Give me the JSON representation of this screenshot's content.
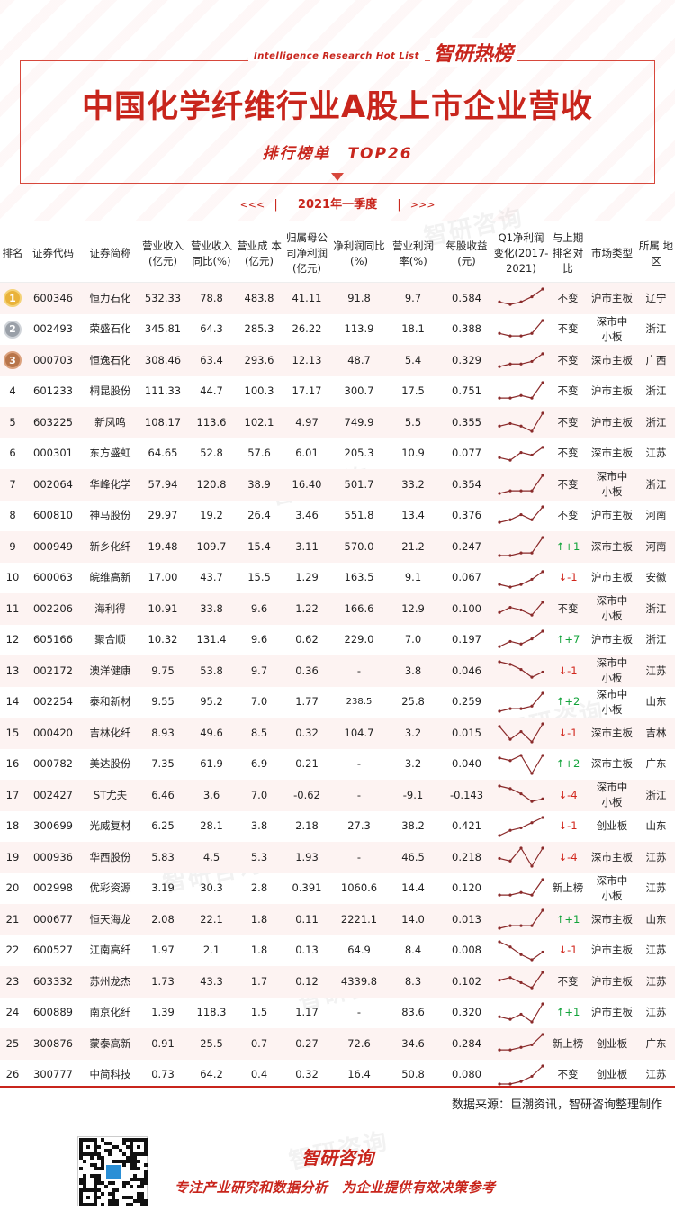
{
  "header": {
    "en_label": "Intelligence Research Hot List",
    "cn_label": "智研热榜",
    "title": "中国化学纤维行业A股上市企业营收",
    "subtitle": "排行榜单　TOP26",
    "period": "2021年一季度",
    "period_left_arrows": "<<<",
    "period_right_arrows": ">>>"
  },
  "columns": {
    "rank": "排名",
    "code": "证券代码",
    "name": "证券简称",
    "rev": "营业收入 (亿元)",
    "rev_yoy": "营业收入 同比(%)",
    "cost": "营业成 本(亿元)",
    "net_profit": "归属母公 司净利润 (亿元)",
    "np_yoy": "净利润同比 (%)",
    "margin": "营业利润 率(%)",
    "eps": "每股收益 (元)",
    "spark": "Q1净利润 变化(2017- 2021)",
    "rank_change": "与上期 排名对 比",
    "market": "市场类型",
    "region": "所属 地区"
  },
  "rows": [
    {
      "rank": "1",
      "code": "600346",
      "name": "恒力石化",
      "rev": "532.33",
      "rev_yoy": "78.8",
      "cost": "483.8",
      "np": "41.11",
      "np_yoy": "91.8",
      "margin": "9.7",
      "eps": "0.584",
      "change": "不变",
      "market": "沪市主板",
      "region": "辽宁",
      "trend": [
        3,
        2,
        3,
        5,
        8
      ]
    },
    {
      "rank": "2",
      "code": "002493",
      "name": "荣盛石化",
      "rev": "345.81",
      "rev_yoy": "64.3",
      "cost": "285.3",
      "np": "26.22",
      "np_yoy": "113.9",
      "margin": "18.1",
      "eps": "0.388",
      "change": "不变",
      "market": "深市中小板",
      "region": "浙江",
      "trend": [
        3,
        2,
        2,
        3,
        8
      ]
    },
    {
      "rank": "3",
      "code": "000703",
      "name": "恒逸石化",
      "rev": "308.46",
      "rev_yoy": "63.4",
      "cost": "293.6",
      "np": "12.13",
      "np_yoy": "48.7",
      "margin": "5.4",
      "eps": "0.329",
      "change": "不变",
      "market": "深市主板",
      "region": "广西",
      "trend": [
        2,
        3,
        3,
        4,
        7
      ]
    },
    {
      "rank": "4",
      "code": "601233",
      "name": "桐昆股份",
      "rev": "111.33",
      "rev_yoy": "44.7",
      "cost": "100.3",
      "np": "17.17",
      "np_yoy": "300.7",
      "margin": "17.5",
      "eps": "0.751",
      "change": "不变",
      "market": "沪市主板",
      "region": "浙江",
      "trend": [
        2,
        2,
        3,
        2,
        8
      ]
    },
    {
      "rank": "5",
      "code": "603225",
      "name": "新凤鸣",
      "rev": "108.17",
      "rev_yoy": "113.6",
      "cost": "102.1",
      "np": "4.97",
      "np_yoy": "749.9",
      "margin": "5.5",
      "eps": "0.355",
      "change": "不变",
      "market": "沪市主板",
      "region": "浙江",
      "trend": [
        3,
        4,
        3,
        1,
        8
      ]
    },
    {
      "rank": "6",
      "code": "000301",
      "name": "东方盛虹",
      "rev": "64.65",
      "rev_yoy": "52.8",
      "cost": "57.6",
      "np": "6.01",
      "np_yoy": "205.3",
      "margin": "10.9",
      "eps": "0.077",
      "change": "不变",
      "market": "深市主板",
      "region": "江苏",
      "trend": [
        3,
        2,
        5,
        4,
        7
      ]
    },
    {
      "rank": "7",
      "code": "002064",
      "name": "华峰化学",
      "rev": "57.94",
      "rev_yoy": "120.8",
      "cost": "38.9",
      "np": "16.40",
      "np_yoy": "501.7",
      "margin": "33.2",
      "eps": "0.354",
      "change": "不变",
      "market": "深市中小板",
      "region": "浙江",
      "trend": [
        1,
        2,
        2,
        2,
        8
      ]
    },
    {
      "rank": "8",
      "code": "600810",
      "name": "神马股份",
      "rev": "29.97",
      "rev_yoy": "19.2",
      "cost": "26.4",
      "np": "3.46",
      "np_yoy": "551.8",
      "margin": "13.4",
      "eps": "0.376",
      "change": "不变",
      "market": "沪市主板",
      "region": "河南",
      "trend": [
        2,
        3,
        5,
        3,
        8
      ]
    },
    {
      "rank": "9",
      "code": "000949",
      "name": "新乡化纤",
      "rev": "19.48",
      "rev_yoy": "109.7",
      "cost": "15.4",
      "np": "3.11",
      "np_yoy": "570.0",
      "margin": "21.2",
      "eps": "0.247",
      "change": "↑+1",
      "market": "深市主板",
      "region": "河南",
      "trend": [
        1,
        1,
        2,
        2,
        8
      ]
    },
    {
      "rank": "10",
      "code": "600063",
      "name": "皖维高新",
      "rev": "17.00",
      "rev_yoy": "43.7",
      "cost": "15.5",
      "np": "1.29",
      "np_yoy": "163.5",
      "margin": "9.1",
      "eps": "0.067",
      "change": "↓-1",
      "market": "沪市主板",
      "region": "安徽",
      "trend": [
        2,
        1,
        2,
        4,
        7
      ]
    },
    {
      "rank": "11",
      "code": "002206",
      "name": "海利得",
      "rev": "10.91",
      "rev_yoy": "33.8",
      "cost": "9.6",
      "np": "1.22",
      "np_yoy": "166.6",
      "margin": "12.9",
      "eps": "0.100",
      "change": "不变",
      "market": "深市中小板",
      "region": "浙江",
      "trend": [
        3,
        5,
        4,
        2,
        7
      ]
    },
    {
      "rank": "12",
      "code": "605166",
      "name": "聚合顺",
      "rev": "10.32",
      "rev_yoy": "131.4",
      "cost": "9.6",
      "np": "0.62",
      "np_yoy": "229.0",
      "margin": "7.0",
      "eps": "0.197",
      "change": "↑+7",
      "market": "沪市主板",
      "region": "浙江",
      "trend": [
        2,
        4,
        3,
        5,
        8
      ]
    },
    {
      "rank": "13",
      "code": "002172",
      "name": "澳洋健康",
      "rev": "9.75",
      "rev_yoy": "53.8",
      "cost": "9.7",
      "np": "0.36",
      "np_yoy": "-",
      "margin": "3.8",
      "eps": "0.046",
      "change": "↓-1",
      "market": "深市中小板",
      "region": "江苏",
      "trend": [
        8,
        7,
        5,
        2,
        4
      ]
    },
    {
      "rank": "14",
      "code": "002254",
      "name": "泰和新材",
      "rev": "9.55",
      "rev_yoy": "95.2",
      "cost": "7.0",
      "np": "1.77",
      "np_yoy": "238.5",
      "margin": "25.8",
      "eps": "0.259",
      "change": "↑+2",
      "market": "深市中小板",
      "region": "山东",
      "trend": [
        1,
        2,
        2,
        3,
        8
      ]
    },
    {
      "rank": "15",
      "code": "000420",
      "name": "吉林化纤",
      "rev": "8.93",
      "rev_yoy": "49.6",
      "cost": "8.5",
      "np": "0.32",
      "np_yoy": "104.7",
      "margin": "3.2",
      "eps": "0.015",
      "change": "↓-1",
      "market": "深市主板",
      "region": "吉林",
      "trend": [
        7,
        2,
        5,
        1,
        8
      ]
    },
    {
      "rank": "16",
      "code": "000782",
      "name": "美达股份",
      "rev": "7.35",
      "rev_yoy": "61.9",
      "cost": "6.9",
      "np": "0.21",
      "np_yoy": "-",
      "margin": "3.2",
      "eps": "0.040",
      "change": "↑+2",
      "market": "深市主板",
      "region": "广东",
      "trend": [
        7,
        6,
        8,
        1,
        8
      ]
    },
    {
      "rank": "17",
      "code": "002427",
      "name": "ST尤夫",
      "rev": "6.46",
      "rev_yoy": "3.6",
      "cost": "7.0",
      "np": "-0.62",
      "np_yoy": "-",
      "margin": "-9.1",
      "eps": "-0.143",
      "change": "↓-4",
      "market": "深市中小板",
      "region": "浙江",
      "trend": [
        8,
        7,
        5,
        2,
        3
      ]
    },
    {
      "rank": "18",
      "code": "300699",
      "name": "光威复材",
      "rev": "6.25",
      "rev_yoy": "28.1",
      "cost": "3.8",
      "np": "2.18",
      "np_yoy": "27.3",
      "margin": "38.2",
      "eps": "0.421",
      "change": "↓-1",
      "market": "创业板",
      "region": "山东",
      "trend": [
        1,
        3,
        4,
        6,
        8
      ]
    },
    {
      "rank": "19",
      "code": "000936",
      "name": "华西股份",
      "rev": "5.83",
      "rev_yoy": "4.5",
      "cost": "5.3",
      "np": "1.93",
      "np_yoy": "-",
      "margin": "46.5",
      "eps": "0.218",
      "change": "↓-4",
      "market": "深市主板",
      "region": "江苏",
      "trend": [
        4,
        3,
        8,
        1,
        8
      ]
    },
    {
      "rank": "20",
      "code": "002998",
      "name": "优彩资源",
      "rev": "3.19",
      "rev_yoy": "30.3",
      "cost": "2.8",
      "np": "0.391",
      "np_yoy": "1060.6",
      "margin": "14.4",
      "eps": "0.120",
      "change": "新上榜",
      "market": "深市中小板",
      "region": "江苏",
      "trend": [
        2,
        2,
        3,
        2,
        8
      ]
    },
    {
      "rank": "21",
      "code": "000677",
      "name": "恒天海龙",
      "rev": "2.08",
      "rev_yoy": "22.1",
      "cost": "1.8",
      "np": "0.11",
      "np_yoy": "2221.1",
      "margin": "14.0",
      "eps": "0.013",
      "change": "↑+1",
      "market": "深市主板",
      "region": "山东",
      "trend": [
        1,
        2,
        2,
        2,
        8
      ]
    },
    {
      "rank": "22",
      "code": "600527",
      "name": "江南高纤",
      "rev": "1.97",
      "rev_yoy": "2.1",
      "cost": "1.8",
      "np": "0.13",
      "np_yoy": "64.9",
      "margin": "8.4",
      "eps": "0.008",
      "change": "↓-1",
      "market": "沪市主板",
      "region": "江苏",
      "trend": [
        8,
        6,
        3,
        1,
        4
      ]
    },
    {
      "rank": "23",
      "code": "603332",
      "name": "苏州龙杰",
      "rev": "1.73",
      "rev_yoy": "43.3",
      "cost": "1.7",
      "np": "0.12",
      "np_yoy": "4339.8",
      "margin": "8.3",
      "eps": "0.102",
      "change": "不变",
      "market": "沪市主板",
      "region": "江苏",
      "trend": [
        5,
        6,
        4,
        2,
        8
      ]
    },
    {
      "rank": "24",
      "code": "600889",
      "name": "南京化纤",
      "rev": "1.39",
      "rev_yoy": "118.3",
      "cost": "1.5",
      "np": "1.17",
      "np_yoy": "-",
      "margin": "83.6",
      "eps": "0.320",
      "change": "↑+1",
      "market": "沪市主板",
      "region": "江苏",
      "trend": [
        3,
        2,
        4,
        1,
        8
      ]
    },
    {
      "rank": "25",
      "code": "300876",
      "name": "蒙泰高新",
      "rev": "0.91",
      "rev_yoy": "25.5",
      "cost": "0.7",
      "np": "0.27",
      "np_yoy": "72.6",
      "margin": "34.6",
      "eps": "0.284",
      "change": "新上榜",
      "market": "创业板",
      "region": "广东",
      "trend": [
        2,
        2,
        3,
        4,
        8
      ]
    },
    {
      "rank": "26",
      "code": "300777",
      "name": "中简科技",
      "rev": "0.73",
      "rev_yoy": "64.2",
      "cost": "0.4",
      "np": "0.32",
      "np_yoy": "16.4",
      "margin": "50.8",
      "eps": "0.080",
      "change": "不变",
      "market": "创业板",
      "region": "江苏",
      "trend": [
        1,
        1,
        2,
        4,
        8
      ]
    }
  ],
  "source": "数据来源：巨潮资讯，智研咨询整理制作",
  "footer": {
    "brand": "智研咨询",
    "slogan": "专注产业研究和数据分析　为企业提供有效决策参考",
    "watermark": "智研咨询"
  },
  "colors": {
    "accent": "#c8251c",
    "up": "#12a33a",
    "down": "#d1261c",
    "spark_line": "#8a2a2a",
    "row_alt": "#fdf3f2"
  }
}
